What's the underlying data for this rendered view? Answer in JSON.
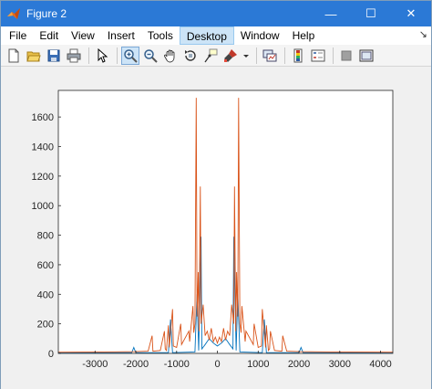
{
  "window": {
    "title": "Figure 2",
    "controls": {
      "minimize": "—",
      "maximize": "☐",
      "close": "✕"
    }
  },
  "menubar": {
    "items": [
      "File",
      "Edit",
      "View",
      "Insert",
      "Tools",
      "Desktop",
      "Window",
      "Help"
    ],
    "active": "Desktop",
    "overflow_arrow": "↘"
  },
  "toolbar": {
    "buttons": [
      "new-figure-icon",
      "open-file-icon",
      "save-icon",
      "print-icon",
      "edit-plot-arrow-icon",
      "zoom-in-icon",
      "zoom-out-icon",
      "pan-hand-icon",
      "rotate-3d-icon",
      "data-cursor-icon",
      "brush-icon",
      "brush-dropdown-icon",
      "link-plot-icon",
      "insert-colorbar-icon",
      "insert-legend-icon",
      "hide-plot-tools-icon",
      "show-plot-tools-icon"
    ],
    "pressed": "zoom-in-icon"
  },
  "chart_data": {
    "type": "line",
    "xlim": [
      -3900,
      4300
    ],
    "ylim": [
      0,
      1780
    ],
    "xticks": [
      -3000,
      -2000,
      -1000,
      0,
      1000,
      2000,
      3000,
      4000
    ],
    "yticks": [
      0,
      200,
      400,
      600,
      800,
      1000,
      1200,
      1400,
      1600
    ],
    "grid": false,
    "series": [
      {
        "color": "#0072bd",
        "points": [
          [
            -3900,
            5
          ],
          [
            -2100,
            5
          ],
          [
            -2050,
            40
          ],
          [
            -2000,
            5
          ],
          [
            -1200,
            5
          ],
          [
            -1150,
            230
          ],
          [
            -1100,
            5
          ],
          [
            -550,
            10
          ],
          [
            -500,
            400
          ],
          [
            -460,
            20
          ],
          [
            -400,
            790
          ],
          [
            -380,
            30
          ],
          [
            -300,
            60
          ],
          [
            -200,
            100
          ],
          [
            -100,
            70
          ],
          [
            0,
            50
          ],
          [
            100,
            70
          ],
          [
            200,
            100
          ],
          [
            300,
            60
          ],
          [
            380,
            30
          ],
          [
            400,
            790
          ],
          [
            460,
            20
          ],
          [
            500,
            400
          ],
          [
            550,
            10
          ],
          [
            1100,
            5
          ],
          [
            1150,
            230
          ],
          [
            1200,
            5
          ],
          [
            2000,
            5
          ],
          [
            2050,
            40
          ],
          [
            2100,
            5
          ],
          [
            4300,
            5
          ]
        ]
      },
      {
        "color": "#d95319",
        "points": [
          [
            -3900,
            8
          ],
          [
            -2800,
            10
          ],
          [
            -2000,
            12
          ],
          [
            -1700,
            15
          ],
          [
            -1600,
            120
          ],
          [
            -1580,
            15
          ],
          [
            -1400,
            20
          ],
          [
            -1300,
            150
          ],
          [
            -1280,
            30
          ],
          [
            -1250,
            20
          ],
          [
            -1200,
            190
          ],
          [
            -1180,
            40
          ],
          [
            -1100,
            300
          ],
          [
            -1080,
            50
          ],
          [
            -1000,
            40
          ],
          [
            -900,
            200
          ],
          [
            -880,
            60
          ],
          [
            -700,
            150
          ],
          [
            -680,
            80
          ],
          [
            -600,
            320
          ],
          [
            -580,
            140
          ],
          [
            -550,
            200
          ],
          [
            -520,
            1730
          ],
          [
            -500,
            250
          ],
          [
            -470,
            550
          ],
          [
            -450,
            150
          ],
          [
            -420,
            1130
          ],
          [
            -400,
            200
          ],
          [
            -350,
            330
          ],
          [
            -300,
            120
          ],
          [
            -250,
            150
          ],
          [
            -200,
            90
          ],
          [
            -150,
            170
          ],
          [
            -100,
            80
          ],
          [
            -50,
            110
          ],
          [
            0,
            70
          ],
          [
            50,
            110
          ],
          [
            100,
            80
          ],
          [
            150,
            170
          ],
          [
            200,
            90
          ],
          [
            250,
            150
          ],
          [
            300,
            120
          ],
          [
            350,
            330
          ],
          [
            400,
            200
          ],
          [
            420,
            1130
          ],
          [
            450,
            150
          ],
          [
            470,
            550
          ],
          [
            500,
            250
          ],
          [
            520,
            1730
          ],
          [
            550,
            200
          ],
          [
            580,
            140
          ],
          [
            600,
            320
          ],
          [
            680,
            80
          ],
          [
            700,
            150
          ],
          [
            880,
            60
          ],
          [
            900,
            200
          ],
          [
            1000,
            40
          ],
          [
            1080,
            50
          ],
          [
            1100,
            300
          ],
          [
            1180,
            40
          ],
          [
            1200,
            190
          ],
          [
            1250,
            20
          ],
          [
            1280,
            30
          ],
          [
            1300,
            150
          ],
          [
            1400,
            20
          ],
          [
            1580,
            15
          ],
          [
            1600,
            120
          ],
          [
            1700,
            15
          ],
          [
            2000,
            12
          ],
          [
            2800,
            10
          ],
          [
            4300,
            8
          ]
        ]
      }
    ]
  }
}
